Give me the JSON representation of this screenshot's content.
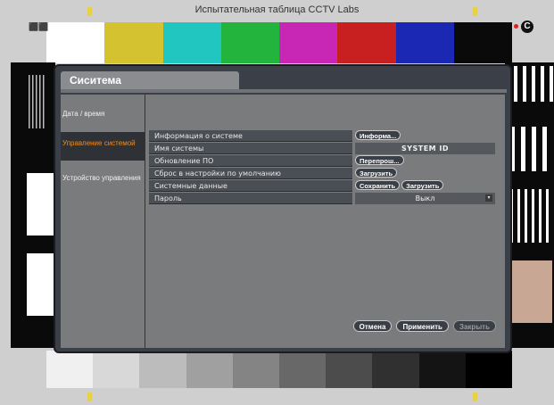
{
  "test_chart": {
    "title": "Испытательная таблица CCTV Labs",
    "colors": [
      "#ffffff",
      "#d4c230",
      "#22c6c0",
      "#22b43c",
      "#c826b4",
      "#c82020",
      "#1a28b4",
      "#0a0a0a"
    ],
    "gray_levels": [
      "#f0f0f0",
      "#d8d8d8",
      "#bcbcbc",
      "#a0a0a0",
      "#848484",
      "#686868",
      "#4c4c4c",
      "#303030",
      "#141414",
      "#000000"
    ]
  },
  "dialog": {
    "title": "Сиситема",
    "sidebar": [
      {
        "label": "Дата / время",
        "active": false
      },
      {
        "label": "Управление системой",
        "active": true
      },
      {
        "label": "Устройство управления",
        "active": false
      }
    ],
    "rows": [
      {
        "label": "Информация о системе",
        "buttons": [
          "Информа..."
        ]
      },
      {
        "label": "Имя системы",
        "value": "SYSTEM ID"
      },
      {
        "label": "Обновление ПО",
        "buttons": [
          "Перепрош..."
        ]
      },
      {
        "label": "Сброс в настройки по умолчанию",
        "buttons": [
          "Загрузить"
        ]
      },
      {
        "label": "Системные данные",
        "buttons": [
          "Сохранить",
          "Загрузить"
        ]
      },
      {
        "label": "Пароль",
        "dropdown": "Выкл"
      }
    ],
    "footer": {
      "cancel": "Отмена",
      "apply": "Применить",
      "close": "Закрыть"
    }
  }
}
